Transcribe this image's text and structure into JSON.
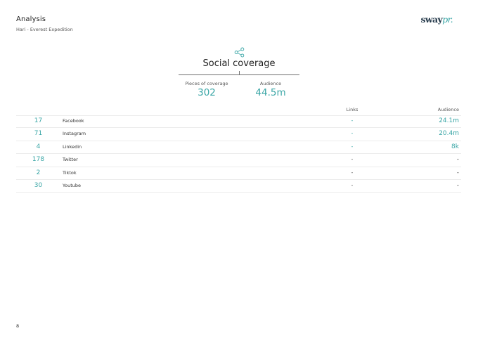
{
  "header": {
    "title": "Analysis",
    "subtitle": "Hari - Everest Expedition"
  },
  "logo": {
    "main": "sway",
    "accent": "pr."
  },
  "section": {
    "icon": "share-icon",
    "title": "Social coverage"
  },
  "stats": [
    {
      "label": "Pieces of coverage",
      "value": "302"
    },
    {
      "label": "Audience",
      "value": "44.5m"
    }
  ],
  "table": {
    "headers": {
      "links": "Links",
      "audience": "Audience"
    },
    "rows": [
      {
        "count": "17",
        "platform": "Facebook",
        "links": "-",
        "audience": "24.1m"
      },
      {
        "count": "71",
        "platform": "Instagram",
        "links": "-",
        "audience": "20.4m"
      },
      {
        "count": "4",
        "platform": "Linkedin",
        "links": "-",
        "audience": "8k"
      },
      {
        "count": "178",
        "platform": "Twitter",
        "links": "-",
        "audience": "-"
      },
      {
        "count": "2",
        "platform": "Tiktok",
        "links": "-",
        "audience": "-"
      },
      {
        "count": "30",
        "platform": "Youtube",
        "links": "-",
        "audience": "-"
      }
    ]
  },
  "page_number": "8",
  "colors": {
    "accent": "#3aa6a6",
    "brand": "#24394a",
    "text": "#333333"
  }
}
